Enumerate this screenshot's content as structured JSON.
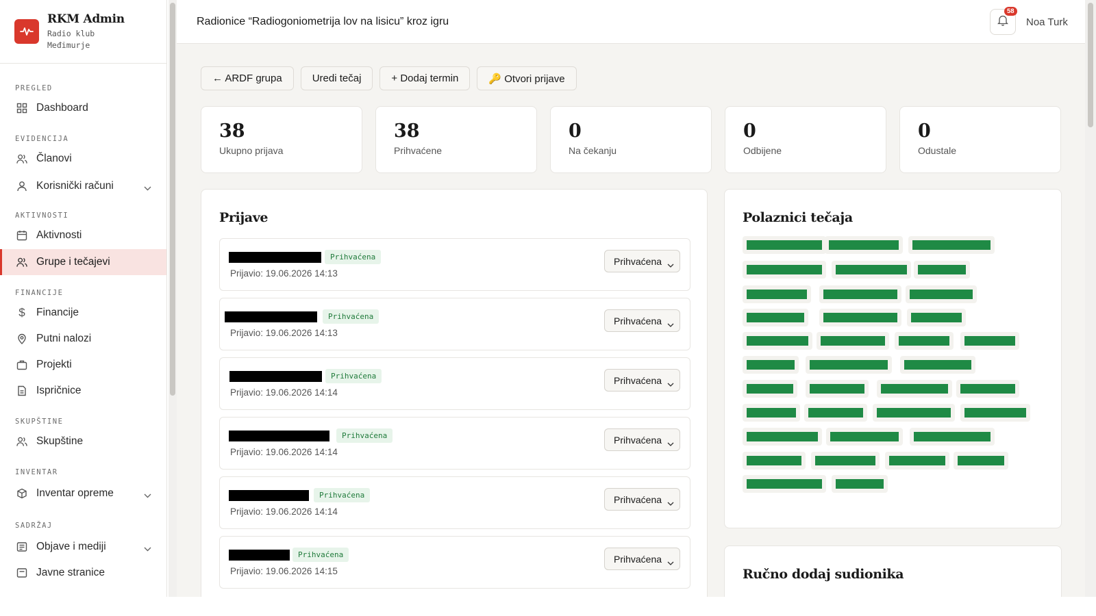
{
  "brand": {
    "name": "RKM Admin",
    "sub_line1": "Radio klub",
    "sub_line2": "Međimurje"
  },
  "sidebar": {
    "sections": [
      {
        "label": "PREGLED",
        "items": [
          {
            "label": "Dashboard",
            "icon": "grid-icon"
          }
        ]
      },
      {
        "label": "EVIDENCIJA",
        "items": [
          {
            "label": "Članovi",
            "icon": "users-icon"
          },
          {
            "label": "Korisnički računi",
            "icon": "user-icon",
            "expandable": true
          }
        ]
      },
      {
        "label": "AKTIVNOSTI",
        "items": [
          {
            "label": "Aktivnosti",
            "icon": "calendar-icon"
          },
          {
            "label": "Grupe i tečajevi",
            "icon": "users-icon",
            "active": true
          }
        ]
      },
      {
        "label": "FINANCIJE",
        "items": [
          {
            "label": "Financije",
            "icon": "dollar-icon"
          },
          {
            "label": "Putni nalozi",
            "icon": "map-pin-icon"
          },
          {
            "label": "Projekti",
            "icon": "briefcase-icon"
          },
          {
            "label": "Ispričnice",
            "icon": "document-icon"
          }
        ]
      },
      {
        "label": "SKUPŠTINE",
        "items": [
          {
            "label": "Skupštine",
            "icon": "users-icon"
          }
        ]
      },
      {
        "label": "INVENTAR",
        "items": [
          {
            "label": "Inventar opreme",
            "icon": "box-icon",
            "expandable": true
          }
        ]
      },
      {
        "label": "SADRŽAJ",
        "items": [
          {
            "label": "Objave i mediji",
            "icon": "news-icon",
            "expandable": true
          },
          {
            "label": "Javne stranice",
            "icon": "page-icon"
          }
        ]
      }
    ]
  },
  "header": {
    "title": "Radionice “Radiogoniometrija lov na lisicu” kroz igru",
    "notification_count": "58",
    "user_name": "Noa Turk"
  },
  "actions": {
    "back": "← ARDF grupa",
    "edit": "Uredi tečaj",
    "add_term": "+ Dodaj termin",
    "open_applications": "🔑 Otvori prijave"
  },
  "stats": [
    {
      "value": "38",
      "label": "Ukupno prijava"
    },
    {
      "value": "38",
      "label": "Prihvaćene"
    },
    {
      "value": "0",
      "label": "Na čekanju"
    },
    {
      "value": "0",
      "label": "Odbijene"
    },
    {
      "value": "0",
      "label": "Odustale"
    }
  ],
  "applications": {
    "title": "Prijave",
    "rows": [
      {
        "status": "Prihvaćena",
        "date": "Prijavio: 19.06.2026 14:13",
        "select": "Prihvaćena"
      },
      {
        "status": "Prihvaćena",
        "date": "Prijavio: 19.06.2026 14:13",
        "select": "Prihvaćena"
      },
      {
        "status": "Prihvaćena",
        "date": "Prijavio: 19.06.2026 14:14",
        "select": "Prihvaćena"
      },
      {
        "status": "Prihvaćena",
        "date": "Prijavio: 19.06.2026 14:14",
        "select": "Prihvaćena"
      },
      {
        "status": "Prihvaćena",
        "date": "Prijavio: 19.06.2026 14:14",
        "select": "Prihvaćena"
      },
      {
        "status": "Prihvaćena",
        "date": "Prijavio: 19.06.2026 14:15",
        "select": "Prihvaćena"
      }
    ]
  },
  "participants": {
    "title": "Polaznici tečaja",
    "count": 36
  },
  "manual_add": {
    "title": "Ručno dodaj sudionika"
  },
  "colors": {
    "accent": "#d9382c",
    "active_bg": "#f9e3e1",
    "success": "#1f8a45",
    "success_bg": "#e7f4ea"
  }
}
